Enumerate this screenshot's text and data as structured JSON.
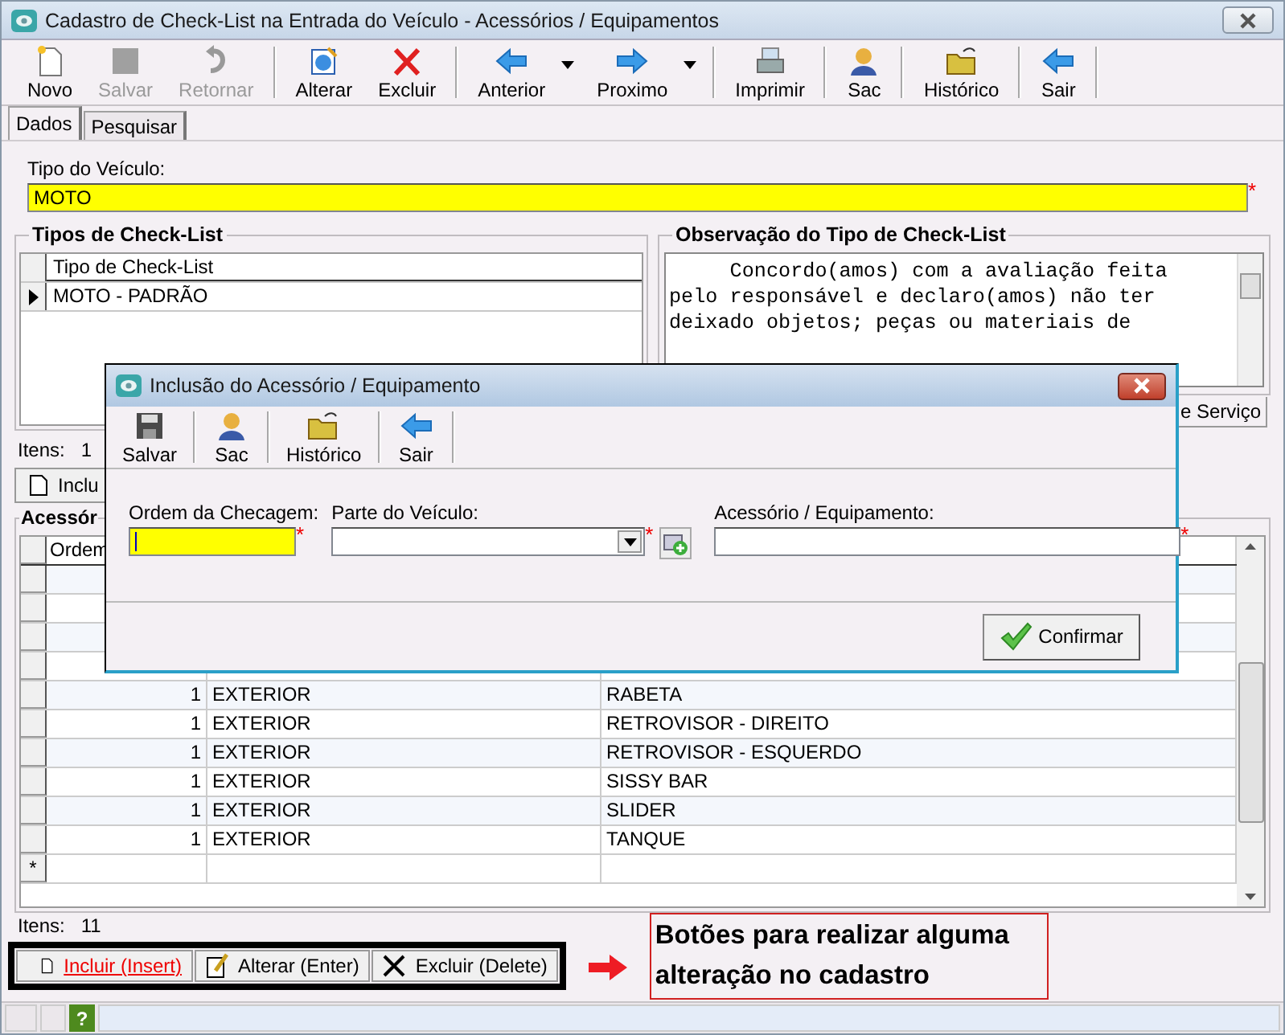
{
  "window": {
    "title": "Cadastro de Check-List na Entrada do Veículo - Acessórios / Equipamentos"
  },
  "toolbar": [
    [
      {
        "label": "Novo",
        "kind": "new",
        "disabled": false,
        "dropdown": false
      },
      {
        "label": "Salvar",
        "kind": "save",
        "disabled": true,
        "dropdown": false
      },
      {
        "label": "Retornar",
        "kind": "undo",
        "disabled": true,
        "dropdown": false
      }
    ],
    [
      {
        "label": "Alterar",
        "kind": "edit",
        "disabled": false,
        "dropdown": false
      },
      {
        "label": "Excluir",
        "kind": "delete",
        "disabled": false,
        "dropdown": false
      }
    ],
    [
      {
        "label": "Anterior",
        "kind": "back",
        "disabled": false,
        "dropdown": true
      },
      {
        "label": "Proximo",
        "kind": "forward",
        "disabled": false,
        "dropdown": true
      }
    ],
    [
      {
        "label": "Imprimir",
        "kind": "print",
        "disabled": false,
        "dropdown": false
      }
    ],
    [
      {
        "label": "Sac",
        "kind": "support",
        "disabled": false,
        "dropdown": false
      }
    ],
    [
      {
        "label": "Histórico",
        "kind": "history",
        "disabled": false,
        "dropdown": false
      }
    ],
    [
      {
        "label": "Sair",
        "kind": "back",
        "disabled": false,
        "dropdown": false
      }
    ]
  ],
  "tabs": [
    {
      "label": "Dados",
      "selected": true
    },
    {
      "label": "Pesquisar",
      "selected": false
    }
  ],
  "vehicle_type": {
    "label": "Tipo do Veículo:",
    "value": "MOTO",
    "required_mark": "*"
  },
  "checklist_types": {
    "title": "Tipos de Check-List",
    "columns": [
      "Tipo de Check-List"
    ],
    "rows": [
      {
        "cells": [
          "MOTO - PADRÃO"
        ],
        "selected": true
      }
    ],
    "items_label": "Itens:",
    "items_count": "1"
  },
  "observation": {
    "title": "Observação do Tipo de Check-List",
    "lines": [
      "     Concordo(amos) com a avaliação feita",
      "pelo responsável e declaro(amos) não ter",
      "deixado objetos; peças ou materiais de"
    ],
    "tab": "e Serviço"
  },
  "include_button": {
    "label": "Inclu"
  },
  "accessories": {
    "title": "Acessór",
    "columns": [
      "Ordem"
    ],
    "rows": [
      {
        "cells": [
          "1",
          "EXTERIOR",
          "RABETA"
        ]
      },
      {
        "cells": [
          "1",
          "EXTERIOR",
          "RETROVISOR - DIREITO"
        ]
      },
      {
        "cells": [
          "1",
          "EXTERIOR",
          "RETROVISOR - ESQUERDO"
        ]
      },
      {
        "cells": [
          "1",
          "EXTERIOR",
          "SISSY BAR"
        ]
      },
      {
        "cells": [
          "1",
          "EXTERIOR",
          "SLIDER"
        ]
      },
      {
        "cells": [
          "1",
          "EXTERIOR",
          "TANQUE"
        ]
      }
    ],
    "new_row_marker": "*",
    "items_label": "Itens:",
    "items_count": "11"
  },
  "actions": [
    {
      "label": "Incluir (Insert)",
      "kind": "new",
      "focused": true
    },
    {
      "label": "Alterar (Enter)",
      "kind": "edit",
      "focused": false
    },
    {
      "label": "Excluir (Delete)",
      "kind": "delete",
      "focused": false
    }
  ],
  "callout": {
    "text": "Botões para realizar alguma alteração no cadastro"
  },
  "status_bar": {
    "help": "?"
  },
  "dialog": {
    "title": "Inclusão do Acessório / Equipamento",
    "toolbar": [
      {
        "label": "Salvar",
        "kind": "save"
      },
      {
        "label": "Sac",
        "kind": "support"
      },
      {
        "label": "Histórico",
        "kind": "history"
      },
      {
        "label": "Sair",
        "kind": "back"
      }
    ],
    "fields": [
      {
        "kind": "text",
        "label": "Ordem da Checagem:",
        "required_mark": "*",
        "focused": true
      },
      {
        "kind": "select",
        "label": "Parte do Veículo:",
        "required_mark": "*",
        "focused": false
      },
      {
        "kind": "text",
        "label": "Acessório / Equipamento:",
        "required_mark": "*",
        "focused": false
      }
    ],
    "confirm": "Confirmar"
  }
}
